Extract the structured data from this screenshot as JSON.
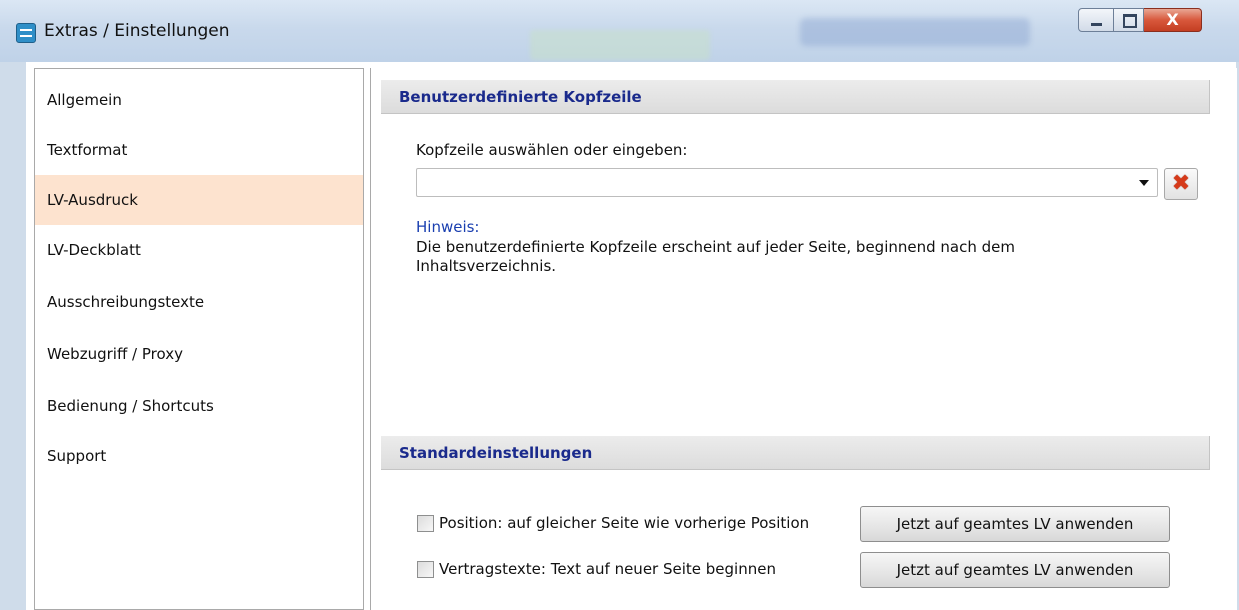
{
  "window": {
    "title": "Extras / Einstellungen",
    "close_glyph": "X"
  },
  "sidebar": {
    "items": [
      {
        "label": "Allgemein"
      },
      {
        "label": "Textformat"
      },
      {
        "label": "LV-Ausdruck",
        "selected": true
      },
      {
        "label": "LV-Deckblatt"
      },
      {
        "label": "Ausschreibungstexte"
      },
      {
        "label": "Webzugriff / Proxy"
      },
      {
        "label": "Bedienung / Shortcuts"
      },
      {
        "label": "Support"
      }
    ]
  },
  "header_section": {
    "title": "Benutzerdefinierte Kopfzeile",
    "field_label": "Kopfzeile auswählen oder eingeben:",
    "field_value": "",
    "clear_icon": "red-x-icon",
    "hint_title": "Hinweis:",
    "hint_line1": "Die benutzerdefinierte Kopfzeile erscheint auf jeder Seite, beginnend nach dem",
    "hint_line2": "Inhaltsverzeichnis."
  },
  "defaults_section": {
    "title": "Standardeinstellungen",
    "options": [
      {
        "label": "Position: auf gleicher Seite wie vorherige Position",
        "checked": false,
        "button": "Jetzt auf geamtes LV anwenden"
      },
      {
        "label": "Vertragstexte: Text auf neuer Seite beginnen",
        "checked": false,
        "button": "Jetzt auf geamtes LV anwenden"
      }
    ]
  },
  "colors": {
    "selected_bg": "#fde3cf",
    "section_title": "#1a2a8c",
    "hint_title": "#1a3fb0"
  }
}
